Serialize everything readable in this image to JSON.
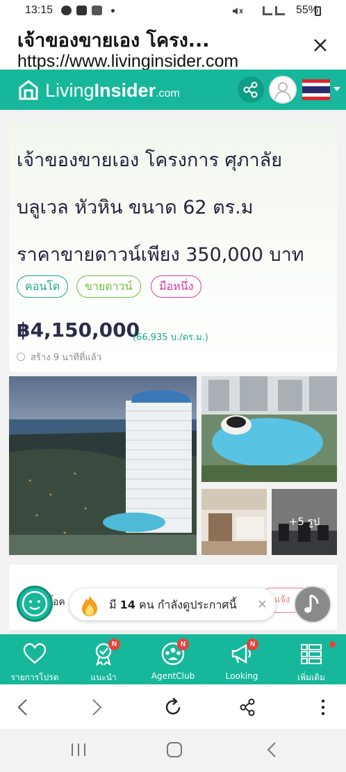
{
  "status_bar": {
    "time": "13:15",
    "battery": "55%"
  },
  "browser_title": {
    "title": "เจ้าของขายเอง โครง...",
    "url": "https://www.livinginsider.com"
  },
  "site_header": {
    "logo_light": "Living",
    "logo_bold": "Insider",
    "logo_suffix": ".com"
  },
  "listing": {
    "title_line1": "เจ้าของขายเอง โครงการ ศุภาลัย",
    "title_line2": "บลูเวล หัวหิน ขนาด 62 ตร.ม",
    "title_line3": "ราคาขายดาวน์เพียง 350,000 บาท",
    "tags": [
      "คอนโด",
      "ขายดาวน์",
      "มือหนึ่ง"
    ],
    "price": "฿4,150,000",
    "price_per_sqm": "(66,935 บ./ตร.ม.)",
    "created": "สร้าง 9 นาทีที่แล้ว",
    "more_photos": "+5 รูป"
  },
  "behind": {
    "text": "้อค",
    "button": "แจ้ง"
  },
  "toast": {
    "prefix": "มี",
    "count": "14",
    "suffix": "คน กำลังดูประกาศนี้",
    "close": "×"
  },
  "bottom_nav": {
    "items": [
      {
        "label": "รายการโปรด",
        "badge": ""
      },
      {
        "label": "แนะนำ",
        "badge": "N"
      },
      {
        "label": "AgentClub",
        "badge": "N"
      },
      {
        "label": "Looking",
        "badge": "N"
      },
      {
        "label": "เพิ่มเติม",
        "badge": ""
      }
    ]
  },
  "colors": {
    "brand": "#17b79b",
    "tag_green": "#1aa58c",
    "tag_lime": "#6bbf3a",
    "tag_pink": "#d63aa0",
    "badge": "#e8423c"
  }
}
